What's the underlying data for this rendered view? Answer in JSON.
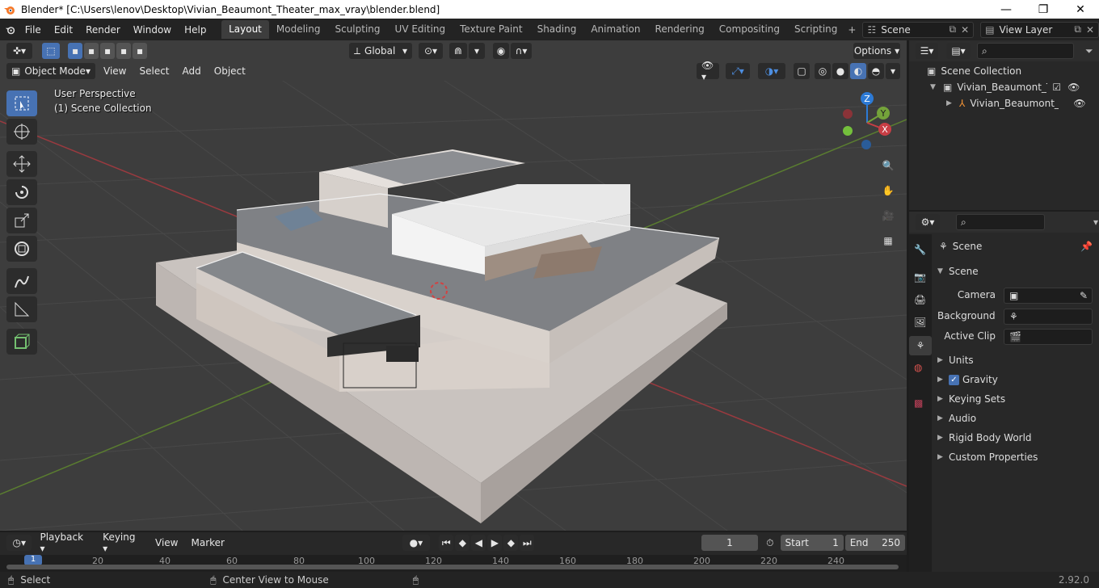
{
  "window": {
    "title": "Blender* [C:\\Users\\lenov\\Desktop\\Vivian_Beaumont_Theater_max_vray\\blender.blend]",
    "minimize": "—",
    "maximize": "❐",
    "close": "✕"
  },
  "menubar": {
    "items": [
      "File",
      "Edit",
      "Render",
      "Window",
      "Help"
    ]
  },
  "workspaces": {
    "tabs": [
      "Layout",
      "Modeling",
      "Sculpting",
      "UV Editing",
      "Texture Paint",
      "Shading",
      "Animation",
      "Rendering",
      "Compositing",
      "Scripting"
    ],
    "active": "Layout"
  },
  "scene_field": {
    "value": "Scene"
  },
  "view_layer_field": {
    "value": "View Layer"
  },
  "viewport": {
    "transform_orientation": "Global",
    "options_label": "Options",
    "mode": "Object Mode",
    "menus": [
      "View",
      "Select",
      "Add",
      "Object"
    ],
    "overlay_title": "User Perspective",
    "overlay_subtitle": "(1) Scene Collection",
    "gizmo": {
      "z": "Z",
      "y": "Y",
      "x": "X"
    }
  },
  "outliner": {
    "items": [
      {
        "label": "Scene Collection"
      },
      {
        "label": "Vivian_Beaumont_Theate"
      },
      {
        "label": "Vivian_Beaumont_Th"
      }
    ]
  },
  "properties": {
    "context": "Scene",
    "panel": "Scene",
    "fields": [
      {
        "label": "Camera"
      },
      {
        "label": "Background ..."
      },
      {
        "label": "Active Clip"
      }
    ],
    "sections": [
      "Units",
      "Gravity",
      "Keying Sets",
      "Audio",
      "Rigid Body World",
      "Custom Properties"
    ]
  },
  "timeline": {
    "menus": [
      "Playback",
      "Keying",
      "View",
      "Marker"
    ],
    "current_frame": "1",
    "start_label": "Start",
    "start_value": "1",
    "end_label": "End",
    "end_value": "250",
    "ruler": [
      "1",
      "20",
      "40",
      "60",
      "80",
      "100",
      "120",
      "140",
      "160",
      "180",
      "200",
      "220",
      "240"
    ]
  },
  "statusbar": {
    "select": "Select",
    "center_view": "Center View to Mouse",
    "version": "2.92.0"
  },
  "colors": {
    "accent": "#4772b3",
    "x_axis": "#c83e45",
    "y_axis": "#74a33a",
    "z_axis": "#2c7ad6"
  }
}
